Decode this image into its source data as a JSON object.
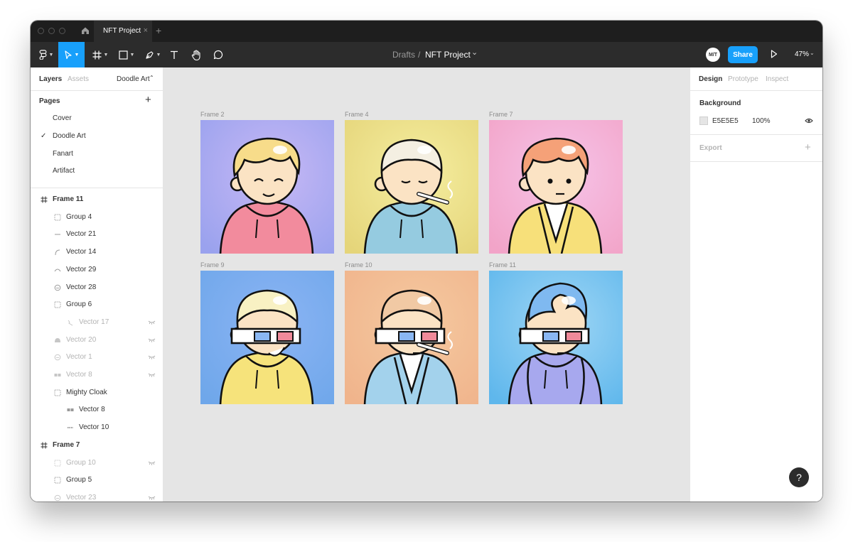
{
  "tabs": [
    {
      "label": "NFT Project",
      "close": "×"
    }
  ],
  "new_tab_symbol": "+",
  "toolbar": {
    "breadcrumb_parent": "Drafts",
    "breadcrumb_sep": "/",
    "file_name": "NFT Project",
    "file_caret": "⌄",
    "avatar_initials": "M/T",
    "share_label": "Share",
    "zoom": "47%"
  },
  "left_panel": {
    "tabs": {
      "layers": "Layers",
      "assets": "Assets",
      "page_name": "Doodle Art"
    },
    "pages_title": "Pages",
    "add_symbol": "+",
    "pages": [
      {
        "label": "Cover",
        "selected": false
      },
      {
        "label": "Doodle Art",
        "selected": true
      },
      {
        "label": "Fanart",
        "selected": false
      },
      {
        "label": "Artifact",
        "selected": false
      }
    ],
    "check_symbol": "✓",
    "layers": [
      {
        "label": "Frame 11",
        "indent": 0,
        "icon": "frame-icon",
        "hidden": false,
        "frame": true
      },
      {
        "label": "Group 4",
        "indent": 1,
        "icon": "group-icon",
        "hidden": false
      },
      {
        "label": "Vector 21",
        "indent": 1,
        "icon": "line-icon",
        "hidden": false
      },
      {
        "label": "Vector 14",
        "indent": 1,
        "icon": "curve-icon",
        "hidden": false
      },
      {
        "label": "Vector 29",
        "indent": 1,
        "icon": "arc-icon",
        "hidden": false
      },
      {
        "label": "Vector 28",
        "indent": 1,
        "icon": "circle-vector-icon",
        "hidden": false
      },
      {
        "label": "Group 6",
        "indent": 1,
        "icon": "group-icon",
        "hidden": false
      },
      {
        "label": "Vector 17",
        "indent": 2,
        "icon": "squiggle-icon",
        "hidden": true,
        "eye": true
      },
      {
        "label": "Vector 20",
        "indent": 1,
        "icon": "hair-vector-icon",
        "hidden": true,
        "eye": true
      },
      {
        "label": "Vector 1",
        "indent": 1,
        "icon": "circle-vector-icon",
        "hidden": true,
        "eye": true
      },
      {
        "label": "Vector 8",
        "indent": 1,
        "icon": "glasses-vector-icon",
        "hidden": true,
        "eye": true
      },
      {
        "label": "Mighty Cloak",
        "indent": 1,
        "icon": "group-icon",
        "hidden": false
      },
      {
        "label": "Vector 8",
        "indent": 2,
        "icon": "glasses-vector-icon",
        "hidden": false
      },
      {
        "label": "Vector 10",
        "indent": 2,
        "icon": "dash-vector-icon",
        "hidden": false
      },
      {
        "label": "Frame 7",
        "indent": 0,
        "icon": "frame-icon",
        "hidden": false,
        "frame": true
      },
      {
        "label": "Group 10",
        "indent": 1,
        "icon": "group-icon",
        "hidden": true,
        "eye": true
      },
      {
        "label": "Group 5",
        "indent": 1,
        "icon": "group-icon",
        "hidden": false
      },
      {
        "label": "Vector 23",
        "indent": 1,
        "icon": "circle-vector-icon",
        "hidden": true,
        "eye": true
      }
    ]
  },
  "canvas": {
    "frames": [
      {
        "label": "Frame 2",
        "bg": [
          "#c7b8f5",
          "#9aa2ee"
        ],
        "hair": "#f7dc8a",
        "hoodie": "#f28b9d",
        "style": "happy"
      },
      {
        "label": "Frame 4",
        "bg": [
          "#f5eea0",
          "#e5d57a"
        ],
        "hair": "#f4efe2",
        "hoodie": "#95cbe0",
        "style": "smoke"
      },
      {
        "label": "Frame 7",
        "bg": [
          "#f6c3e8",
          "#f2a4c8"
        ],
        "hair": "#f5a178",
        "hoodie": "#f7e07a",
        "style": "suit"
      },
      {
        "label": "Frame 9",
        "bg": [
          "#8bb4f4",
          "#6fa7ea"
        ],
        "hair": "#f8f1c3",
        "hoodie": "#f6e37b",
        "style": "glasses-smile"
      },
      {
        "label": "Frame 10",
        "bg": [
          "#f5c9a0",
          "#f0b48c"
        ],
        "hair": "#f1c9a4",
        "hoodie": "#a3d2ec",
        "style": "glasses-smoke"
      },
      {
        "label": "Frame 11",
        "bg": [
          "#9fd6f5",
          "#5fb7ec"
        ],
        "hair": "#7fb9f0",
        "hoodie": "#a7a8ee",
        "style": "glasses-cloak"
      }
    ]
  },
  "right_panel": {
    "tabs": {
      "design": "Design",
      "prototype": "Prototype",
      "inspect": "Inspect"
    },
    "background_title": "Background",
    "background_hex": "E5E5E5",
    "background_opacity": "100%",
    "export_title": "Export",
    "export_add": "+"
  },
  "help_label": "?",
  "colors": {
    "accent": "#18a0fb",
    "toolbar": "#2c2c2c",
    "titlebar": "#1e1e1e",
    "canvas": "#e5e5e5"
  }
}
